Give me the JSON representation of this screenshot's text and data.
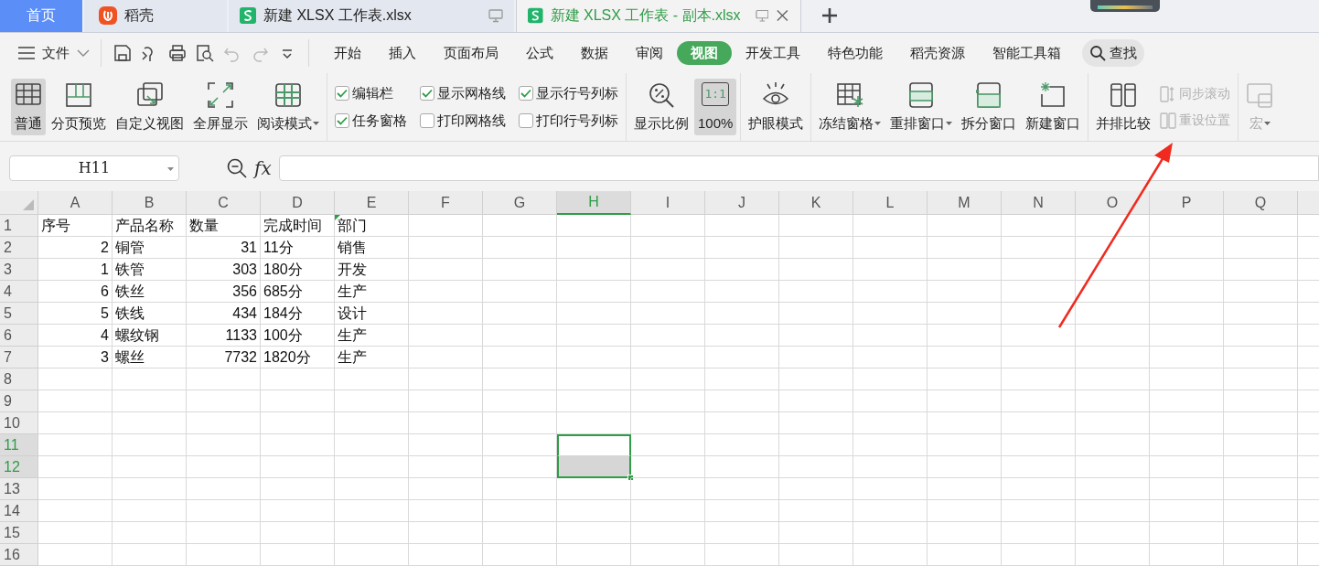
{
  "tabs": [
    {
      "label": "首页",
      "kind": "home",
      "selected": false
    },
    {
      "label": "稻壳",
      "kind": "docer",
      "selected": false
    },
    {
      "label": "新建 XLSX 工作表.xlsx",
      "kind": "sheet",
      "selected": false
    },
    {
      "label": "新建 XLSX 工作表 - 副本.xlsx",
      "kind": "sheet",
      "selected": true
    }
  ],
  "menu": {
    "file": "文件",
    "tabs": [
      {
        "label": "开始",
        "selected": false
      },
      {
        "label": "插入",
        "selected": false
      },
      {
        "label": "页面布局",
        "selected": false
      },
      {
        "label": "公式",
        "selected": false
      },
      {
        "label": "数据",
        "selected": false
      },
      {
        "label": "审阅",
        "selected": false
      },
      {
        "label": "视图",
        "selected": true
      },
      {
        "label": "开发工具",
        "selected": false
      },
      {
        "label": "特色功能",
        "selected": false
      },
      {
        "label": "稻壳资源",
        "selected": false
      },
      {
        "label": "智能工具箱",
        "selected": false
      }
    ],
    "search": "查找"
  },
  "ribbon": [
    {
      "items": [
        {
          "kind": "big",
          "label": "普通",
          "selected": true,
          "disabled": false,
          "dropdown": false
        },
        {
          "kind": "big",
          "label": "分页预览",
          "selected": false,
          "disabled": false,
          "dropdown": false
        },
        {
          "kind": "big",
          "label": "自定义视图",
          "selected": false,
          "disabled": false,
          "dropdown": false
        },
        {
          "kind": "big",
          "label": "全屏显示",
          "selected": false,
          "disabled": false,
          "dropdown": false
        },
        {
          "kind": "big",
          "label": "阅读模式",
          "selected": false,
          "disabled": false,
          "dropdown": true
        }
      ]
    },
    {
      "items": [
        {
          "kind": "check",
          "label": "编辑栏",
          "checked": true
        },
        {
          "kind": "check",
          "label": "任务窗格",
          "checked": true
        },
        {
          "kind": "check",
          "label": "显示网格线",
          "checked": true
        },
        {
          "kind": "check",
          "label": "打印网格线",
          "checked": false
        },
        {
          "kind": "check",
          "label": "显示行号列标",
          "checked": true
        },
        {
          "kind": "check",
          "label": "打印行号列标",
          "checked": false
        }
      ]
    },
    {
      "items": [
        {
          "kind": "big",
          "label": "显示比例",
          "selected": false,
          "disabled": false,
          "dropdown": false
        },
        {
          "kind": "big",
          "label": "100%",
          "icon_text": "1:1",
          "selected": true,
          "disabled": false,
          "dropdown": false
        }
      ]
    },
    {
      "items": [
        {
          "kind": "big",
          "label": "护眼模式",
          "selected": false,
          "disabled": false,
          "dropdown": false
        }
      ]
    },
    {
      "items": [
        {
          "kind": "big",
          "label": "冻结窗格",
          "selected": false,
          "disabled": false,
          "dropdown": true
        },
        {
          "kind": "big",
          "label": "重排窗口",
          "selected": false,
          "disabled": false,
          "dropdown": true
        },
        {
          "kind": "big",
          "label": "拆分窗口",
          "selected": false,
          "disabled": false,
          "dropdown": false
        },
        {
          "kind": "big",
          "label": "新建窗口",
          "selected": false,
          "disabled": false,
          "dropdown": false
        }
      ]
    },
    {
      "items": [
        {
          "kind": "big",
          "label": "并排比较",
          "selected": false,
          "disabled": false,
          "dropdown": false
        },
        {
          "kind": "small",
          "label": "同步滚动",
          "disabled": true
        },
        {
          "kind": "small",
          "label": "重设位置",
          "disabled": true
        }
      ]
    },
    {
      "items": [
        {
          "kind": "big",
          "label": "宏",
          "selected": false,
          "disabled": true,
          "dropdown": true
        }
      ]
    }
  ],
  "formula_bar": {
    "name_box": "H11",
    "fx": "fx"
  },
  "sheet": {
    "columns": [
      {
        "label": "A",
        "selected": false
      },
      {
        "label": "B",
        "selected": false
      },
      {
        "label": "C",
        "selected": false
      },
      {
        "label": "D",
        "selected": false
      },
      {
        "label": "E",
        "selected": false
      },
      {
        "label": "F",
        "selected": false
      },
      {
        "label": "G",
        "selected": false
      },
      {
        "label": "H",
        "selected": true
      },
      {
        "label": "I",
        "selected": false
      },
      {
        "label": "J",
        "selected": false
      },
      {
        "label": "K",
        "selected": false
      },
      {
        "label": "L",
        "selected": false
      },
      {
        "label": "M",
        "selected": false
      },
      {
        "label": "N",
        "selected": false
      },
      {
        "label": "O",
        "selected": false
      },
      {
        "label": "P",
        "selected": false
      },
      {
        "label": "Q",
        "selected": false
      }
    ],
    "rows": [
      {
        "label": "1",
        "selected": false,
        "cells": [
          {
            "text": "序号",
            "kind": "text"
          },
          {
            "text": "产品名称",
            "kind": "text"
          },
          {
            "text": "数量",
            "kind": "text"
          },
          {
            "text": "完成时间",
            "kind": "text"
          },
          {
            "text": "部门",
            "kind": "text",
            "marked": true
          }
        ]
      },
      {
        "label": "2",
        "selected": false,
        "cells": [
          {
            "text": "2",
            "kind": "number"
          },
          {
            "text": "铜管",
            "kind": "text"
          },
          {
            "text": "31",
            "kind": "number"
          },
          {
            "text": "11分",
            "kind": "text"
          },
          {
            "text": "销售",
            "kind": "text"
          }
        ]
      },
      {
        "label": "3",
        "selected": false,
        "cells": [
          {
            "text": "1",
            "kind": "number"
          },
          {
            "text": "铁管",
            "kind": "text"
          },
          {
            "text": "303",
            "kind": "number"
          },
          {
            "text": "180分",
            "kind": "text"
          },
          {
            "text": "开发",
            "kind": "text"
          }
        ]
      },
      {
        "label": "4",
        "selected": false,
        "cells": [
          {
            "text": "6",
            "kind": "number"
          },
          {
            "text": "铁丝",
            "kind": "text"
          },
          {
            "text": "356",
            "kind": "number"
          },
          {
            "text": "685分",
            "kind": "text"
          },
          {
            "text": "生产",
            "kind": "text"
          }
        ]
      },
      {
        "label": "5",
        "selected": false,
        "cells": [
          {
            "text": "5",
            "kind": "number"
          },
          {
            "text": "铁线",
            "kind": "text"
          },
          {
            "text": "434",
            "kind": "number"
          },
          {
            "text": "184分",
            "kind": "text"
          },
          {
            "text": "设计",
            "kind": "text"
          }
        ]
      },
      {
        "label": "6",
        "selected": false,
        "cells": [
          {
            "text": "4",
            "kind": "number"
          },
          {
            "text": "螺纹钢",
            "kind": "text"
          },
          {
            "text": "1133",
            "kind": "number"
          },
          {
            "text": "100分",
            "kind": "text"
          },
          {
            "text": "生产",
            "kind": "text"
          }
        ]
      },
      {
        "label": "7",
        "selected": false,
        "cells": [
          {
            "text": "3",
            "kind": "number"
          },
          {
            "text": "螺丝",
            "kind": "text"
          },
          {
            "text": "7732",
            "kind": "number"
          },
          {
            "text": "1820分",
            "kind": "text"
          },
          {
            "text": "生产",
            "kind": "text"
          }
        ]
      },
      {
        "label": "8",
        "selected": false,
        "cells": []
      },
      {
        "label": "9",
        "selected": false,
        "cells": []
      },
      {
        "label": "10",
        "selected": false,
        "cells": []
      },
      {
        "label": "11",
        "selected": true,
        "cells": []
      },
      {
        "label": "12",
        "selected": true,
        "cells": []
      },
      {
        "label": "13",
        "selected": false,
        "cells": []
      },
      {
        "label": "14",
        "selected": false,
        "cells": []
      },
      {
        "label": "15",
        "selected": false,
        "cells": []
      },
      {
        "label": "16",
        "selected": false,
        "cells": []
      }
    ]
  }
}
